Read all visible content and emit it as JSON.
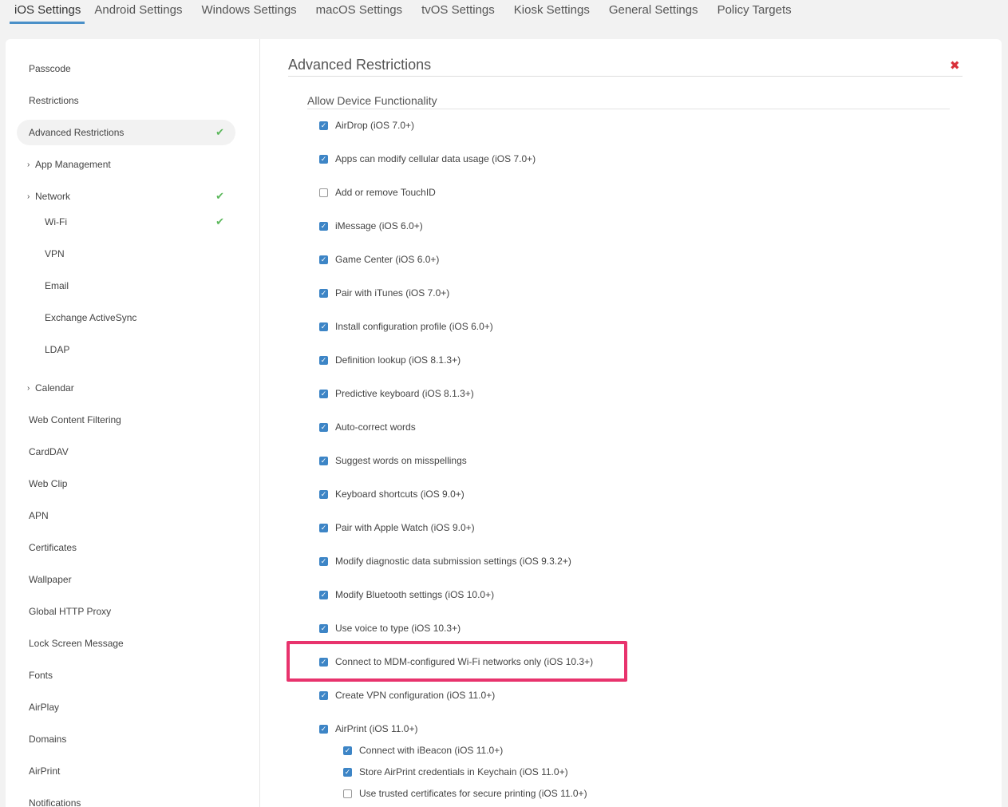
{
  "tabs": [
    {
      "label": "iOS Settings",
      "active": true
    },
    {
      "label": "Android Settings"
    },
    {
      "label": "Windows Settings"
    },
    {
      "label": "macOS Settings"
    },
    {
      "label": "tvOS Settings"
    },
    {
      "label": "Kiosk Settings"
    },
    {
      "label": "General Settings"
    },
    {
      "label": "Policy Targets"
    }
  ],
  "sidebar": {
    "items": [
      {
        "label": "Passcode"
      },
      {
        "label": "Restrictions"
      },
      {
        "label": "Advanced Restrictions",
        "active": true,
        "check": true
      },
      {
        "label": "App Management",
        "chevron": true
      },
      {
        "label": "Network",
        "chevron": true,
        "check": true
      },
      {
        "label": "Wi-Fi",
        "sub": true,
        "check": true
      },
      {
        "label": "VPN",
        "sub": true
      },
      {
        "label": "Email",
        "sub": true
      },
      {
        "label": "Exchange ActiveSync",
        "sub": true
      },
      {
        "label": "LDAP",
        "sub": true
      },
      {
        "label": "Calendar",
        "chevron": true
      },
      {
        "label": "Web Content Filtering"
      },
      {
        "label": "CardDAV"
      },
      {
        "label": "Web Clip"
      },
      {
        "label": "APN"
      },
      {
        "label": "Certificates"
      },
      {
        "label": "Wallpaper"
      },
      {
        "label": "Global HTTP Proxy"
      },
      {
        "label": "Lock Screen Message"
      },
      {
        "label": "Fonts"
      },
      {
        "label": "AirPlay"
      },
      {
        "label": "Domains"
      },
      {
        "label": "AirPrint"
      },
      {
        "label": "Notifications"
      }
    ]
  },
  "main": {
    "title": "Advanced Restrictions",
    "close_icon": "close-x-icon",
    "section": "Allow Device Functionality",
    "options": [
      {
        "label": "AirDrop (iOS 7.0+)",
        "checked": true
      },
      {
        "label": "Apps can modify cellular data usage (iOS 7.0+)",
        "checked": true
      },
      {
        "label": "Add or remove TouchID",
        "checked": false
      },
      {
        "label": "iMessage (iOS 6.0+)",
        "checked": true
      },
      {
        "label": "Game Center (iOS 6.0+)",
        "checked": true
      },
      {
        "label": "Pair with iTunes (iOS 7.0+)",
        "checked": true
      },
      {
        "label": "Install configuration profile (iOS 6.0+)",
        "checked": true
      },
      {
        "label": "Definition lookup (iOS 8.1.3+)",
        "checked": true
      },
      {
        "label": "Predictive keyboard (iOS 8.1.3+)",
        "checked": true
      },
      {
        "label": "Auto-correct words",
        "checked": true
      },
      {
        "label": "Suggest words on misspellings",
        "checked": true
      },
      {
        "label": "Keyboard shortcuts (iOS 9.0+)",
        "checked": true
      },
      {
        "label": "Pair with Apple Watch (iOS 9.0+)",
        "checked": true
      },
      {
        "label": "Modify diagnostic data submission settings (iOS 9.3.2+)",
        "checked": true
      },
      {
        "label": "Modify Bluetooth settings (iOS 10.0+)",
        "checked": true
      },
      {
        "label": "Use voice to type (iOS 10.3+)",
        "checked": true
      },
      {
        "label": "Connect to MDM-configured Wi-Fi networks only (iOS 10.3+)",
        "checked": true,
        "highlighted": true
      },
      {
        "label": "Create VPN configuration (iOS 11.0+)",
        "checked": true
      },
      {
        "label": "AirPrint (iOS 11.0+)",
        "checked": true
      }
    ],
    "sub_options": [
      {
        "label": "Connect with iBeacon (iOS 11.0+)",
        "checked": true
      },
      {
        "label": "Store AirPrint credentials in Keychain (iOS 11.0+)",
        "checked": true
      },
      {
        "label": "Use trusted certificates for secure printing (iOS 11.0+)",
        "checked": false
      }
    ]
  },
  "colors": {
    "accent": "#3d85c6",
    "check_green": "#5cb85c",
    "close_red": "#d9303a",
    "highlight": "#e8336d"
  }
}
